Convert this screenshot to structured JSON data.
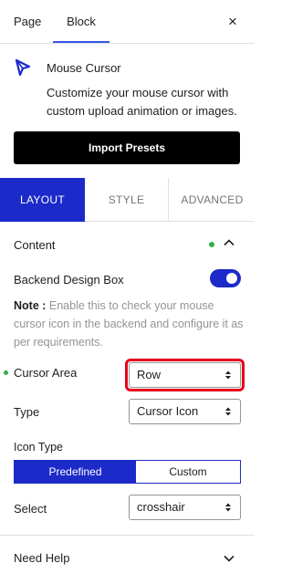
{
  "top_tabs": {
    "page_label": "Page",
    "block_label": "Block"
  },
  "close_icon": "×",
  "block": {
    "name": "Mouse Cursor",
    "description": "Customize your mouse cursor with custom upload animation or images."
  },
  "import_button_label": "Import Presets",
  "sub_tabs": {
    "layout": "LAYOUT",
    "style": "STYLE",
    "advanced": "ADVANCED"
  },
  "content": {
    "title": "Content",
    "backend_box_label": "Backend Design Box",
    "toggle_on": true,
    "note_label": "Note :",
    "note_text": " Enable this to check your mouse cursor icon in the backend and configure it as per requirements.",
    "cursor_area_label": "Cursor Area",
    "cursor_area_value": "Row",
    "type_label": "Type",
    "type_value": "Cursor Icon",
    "icon_type_label": "Icon Type",
    "icon_type_options": [
      "Predefined",
      "Custom"
    ],
    "select_label": "Select",
    "select_value": "crosshair"
  },
  "help": {
    "title": "Need Help"
  },
  "colors": {
    "accent": "#1b2ac8",
    "highlight": "#e4001b",
    "status": "#2fb24a"
  }
}
